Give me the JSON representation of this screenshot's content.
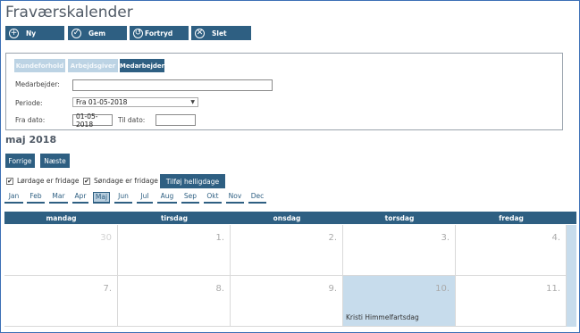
{
  "page_title": "Fraværskalender",
  "toolbar": {
    "buttons": [
      {
        "label": "Ny",
        "icon": "plus-icon",
        "glyph": "+"
      },
      {
        "label": "Gem",
        "icon": "check-icon",
        "glyph": "✓"
      },
      {
        "label": "Fortryd",
        "icon": "undo-icon",
        "glyph": "↺"
      },
      {
        "label": "Slet",
        "icon": "delete-icon",
        "glyph": "✕"
      }
    ]
  },
  "filter": {
    "tabs": [
      {
        "label": "Kundeforhold",
        "active": false
      },
      {
        "label": "Arbejdsgiver",
        "active": false
      },
      {
        "label": "Medarbejder",
        "active": true
      }
    ],
    "employee_label": "Medarbejder:",
    "employee_value": "",
    "period_label": "Periode:",
    "period_value": "Fra 01-05-2018",
    "from_label": "Fra dato:",
    "from_value": "01-05-2018",
    "to_label": "Til dato:",
    "to_value": ""
  },
  "calendar": {
    "month_title": "maj 2018",
    "prev_label": "Forrige",
    "next_label": "Næste",
    "saturday_label": "Lørdage er fridage",
    "saturday_checked": true,
    "sunday_label": "Søndage er fridage",
    "sunday_checked": true,
    "holidays_button": "Tilføj helligdage",
    "months": [
      "Jan",
      "Feb",
      "Mar",
      "Apr",
      "Maj",
      "Jun",
      "Jul",
      "Aug",
      "Sep",
      "Okt",
      "Nov",
      "Dec"
    ],
    "selected_month": "Maj",
    "weekdays": [
      "mandag",
      "tirsdag",
      "onsdag",
      "torsdag",
      "fredag"
    ],
    "weeks": [
      [
        {
          "day": "30",
          "dim": true
        },
        {
          "day": "1."
        },
        {
          "day": "2."
        },
        {
          "day": "3."
        },
        {
          "day": "4."
        }
      ],
      [
        {
          "day": "7."
        },
        {
          "day": "8."
        },
        {
          "day": "9."
        },
        {
          "day": "10.",
          "highlight": true,
          "event": "Kristi Himmelfartsdag"
        },
        {
          "day": "11."
        }
      ]
    ]
  }
}
